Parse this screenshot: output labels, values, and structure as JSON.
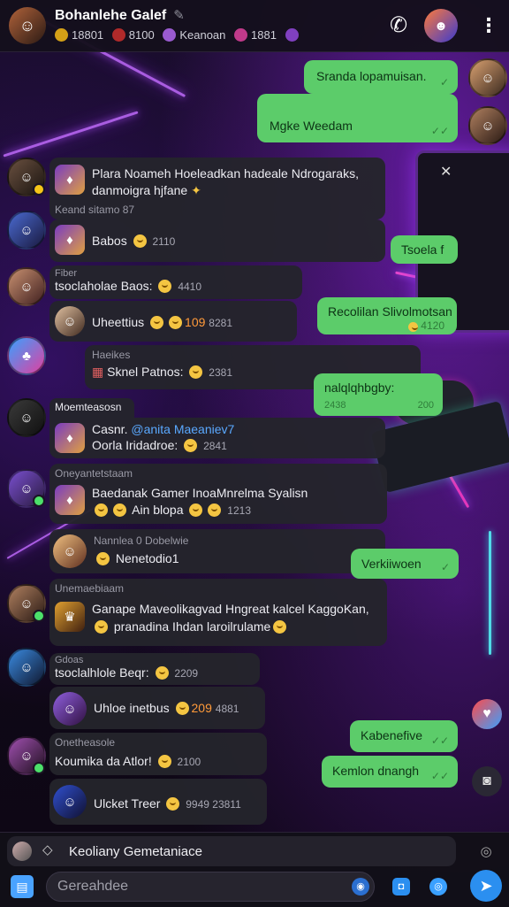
{
  "header": {
    "title": "Bohanlehe Galef",
    "subtitle_parts": [
      {
        "text": "18801",
        "color": "#d4a017"
      },
      {
        "text": "8100",
        "color": "#b02a2a"
      },
      {
        "text": "Keanoan",
        "color": "#9a5bd0"
      },
      {
        "text": "1881",
        "color": "#c03a8a"
      },
      {
        "text": "",
        "color": "#8040c0"
      }
    ],
    "edit_icon": "pencil-icon",
    "call_icon": "phone-icon",
    "more_icon": "more-vertical-icon"
  },
  "messages": {
    "o1": {
      "text": "Sranda lopamuisan.",
      "tick": "✓"
    },
    "o2": {
      "text": "Mgke Weedam",
      "tick": "✓✓"
    },
    "i1": {
      "line1": "Plara Noameh Hoeleadkan hadeale Ndrogaraks,",
      "line2": "danmoigra hjfane",
      "meta": "Keand sitamo  87"
    },
    "i2": {
      "text": "Babos",
      "num": "2110"
    },
    "o3": {
      "text": "Tsoela f"
    },
    "i3": {
      "name": "Fiber",
      "text": "tsoclaholae Baos:",
      "num": "4410"
    },
    "i4": {
      "text": "Uheettius",
      "orange": "109",
      "num": "8281"
    },
    "o4": {
      "text": "Recolilan Slivolmotsan",
      "sub": "4120"
    },
    "i5": {
      "name": "Haeikes",
      "text": "Sknel Patnos:",
      "num": "2381"
    },
    "o5": {
      "text": "nalqlqhbgby:",
      "sub1": "2438",
      "sub2": "200"
    },
    "i6": {
      "name": "Moemteasosn",
      "prefix": "Casnr.",
      "link": "@anita Maeaniev7",
      "line2": "Oorla Iridadroe:",
      "num": "2841"
    },
    "i7": {
      "name": "Oneyantetstaam",
      "line1": "Baedanak Gamer InoaMnrelma Syalisn",
      "line2": "Ain blopa",
      "num": "1213"
    },
    "i8": {
      "name": "Nannlea 0 Dobelwie",
      "text": "Nenetodio1"
    },
    "o6": {
      "text": "Verkiiwoen"
    },
    "i9": {
      "name": "Unemaebiaam",
      "line1": "Ganape Maveolikagvad Hngreat kalcel KaggoKan,",
      "line2": "pranadina Ihdan laroilrulame"
    },
    "i10": {
      "name": "Gdoas",
      "text": "tsoclalhlole Beqr:",
      "num": "2209"
    },
    "i11": {
      "text": "Uhloe inetbus",
      "orange": "209",
      "num": "4881"
    },
    "o7": {
      "text": "Kabenefive",
      "tick": "✓✓"
    },
    "i12": {
      "name": "Onetheasole",
      "text": "Koumika da Atlor!",
      "num": "2100"
    },
    "o8": {
      "text": "Kemlon dnangh",
      "tick": "✓✓"
    },
    "i13": {
      "text": "Ulcket Treer",
      "num": "9949  23811"
    }
  },
  "reply": {
    "text": "Keoliany Gemetaniace"
  },
  "composer": {
    "placeholder": "Gereahdee"
  },
  "colors": {
    "outgoing": "#5ccc6a",
    "incoming": "#24242c",
    "accent": "#2b8ff0"
  }
}
